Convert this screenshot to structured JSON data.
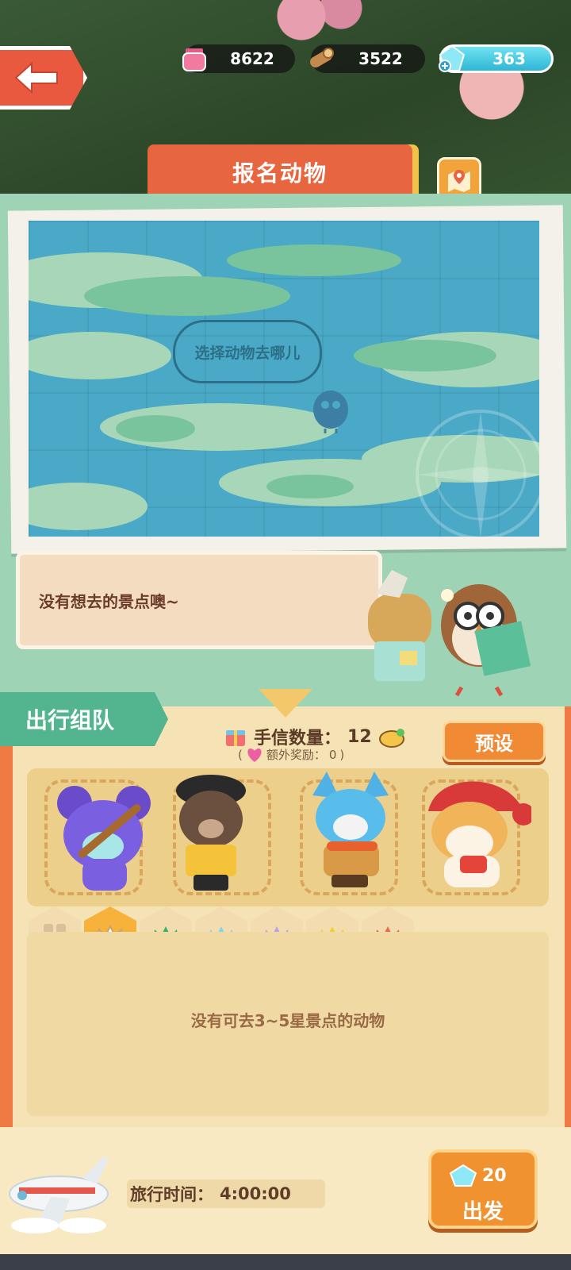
{
  "resources": {
    "ink": "8622",
    "wood": "3522",
    "gems": "363"
  },
  "title": "报名动物",
  "map": {
    "hint": "选择动物去哪儿"
  },
  "dialog": {
    "message": "没有想去的景点噢~"
  },
  "team": {
    "label": "出行组队",
    "letters_label": "手信数量：",
    "letters_count": "12",
    "bonus_label": "额外奖励：",
    "bonus_value": "0",
    "preset_label": "预设",
    "filters": [
      "all-grid-icon",
      "white-crown-icon",
      "green-crown-icon",
      "blue-crown-icon",
      "purple-crown-icon",
      "gold-crown-icon",
      "red-crown-icon"
    ],
    "empty_text": "没有可去3~5星景点的动物"
  },
  "bottom": {
    "time_label": "旅行时间：",
    "time_value": "4:00:00",
    "depart_cost": "20",
    "depart_label": "出发"
  },
  "colors": {
    "accent_orange": "#e8663f",
    "team_green": "#53b58f",
    "sea_blue": "#49a9c6"
  }
}
